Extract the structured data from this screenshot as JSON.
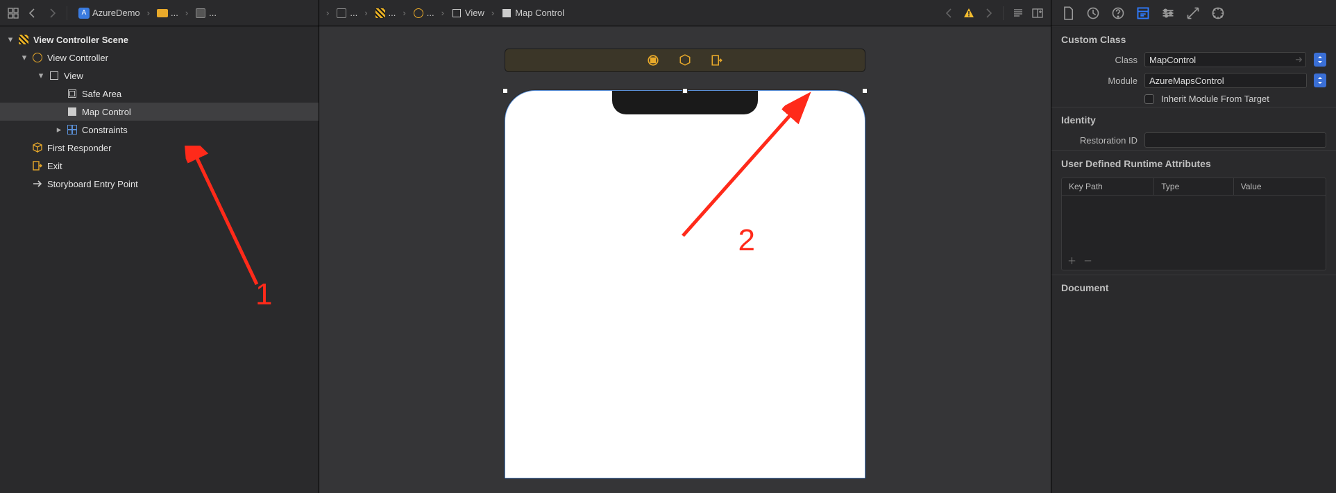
{
  "jumpbar": {
    "project": "AzureDemo",
    "segs": [
      "...",
      "...",
      "...",
      "...",
      "...",
      "View",
      "Map Control"
    ]
  },
  "outline": {
    "scene": "View Controller Scene",
    "vc": "View Controller",
    "view": "View",
    "safe": "Safe Area",
    "mapcontrol": "Map Control",
    "constraints": "Constraints",
    "firstresponder": "First Responder",
    "exit": "Exit",
    "entry": "Storyboard Entry Point"
  },
  "inspector": {
    "customclass": {
      "header": "Custom Class",
      "class_label": "Class",
      "class_value": "MapControl",
      "module_label": "Module",
      "module_value": "AzureMapsControl",
      "inherit_label": "Inherit Module From Target"
    },
    "identity": {
      "header": "Identity",
      "restoration_label": "Restoration ID",
      "restoration_value": ""
    },
    "runtime": {
      "header": "User Defined Runtime Attributes",
      "col_keypath": "Key Path",
      "col_type": "Type",
      "col_value": "Value"
    },
    "document": {
      "header": "Document"
    }
  },
  "annotations": {
    "one": "1",
    "two": "2"
  }
}
